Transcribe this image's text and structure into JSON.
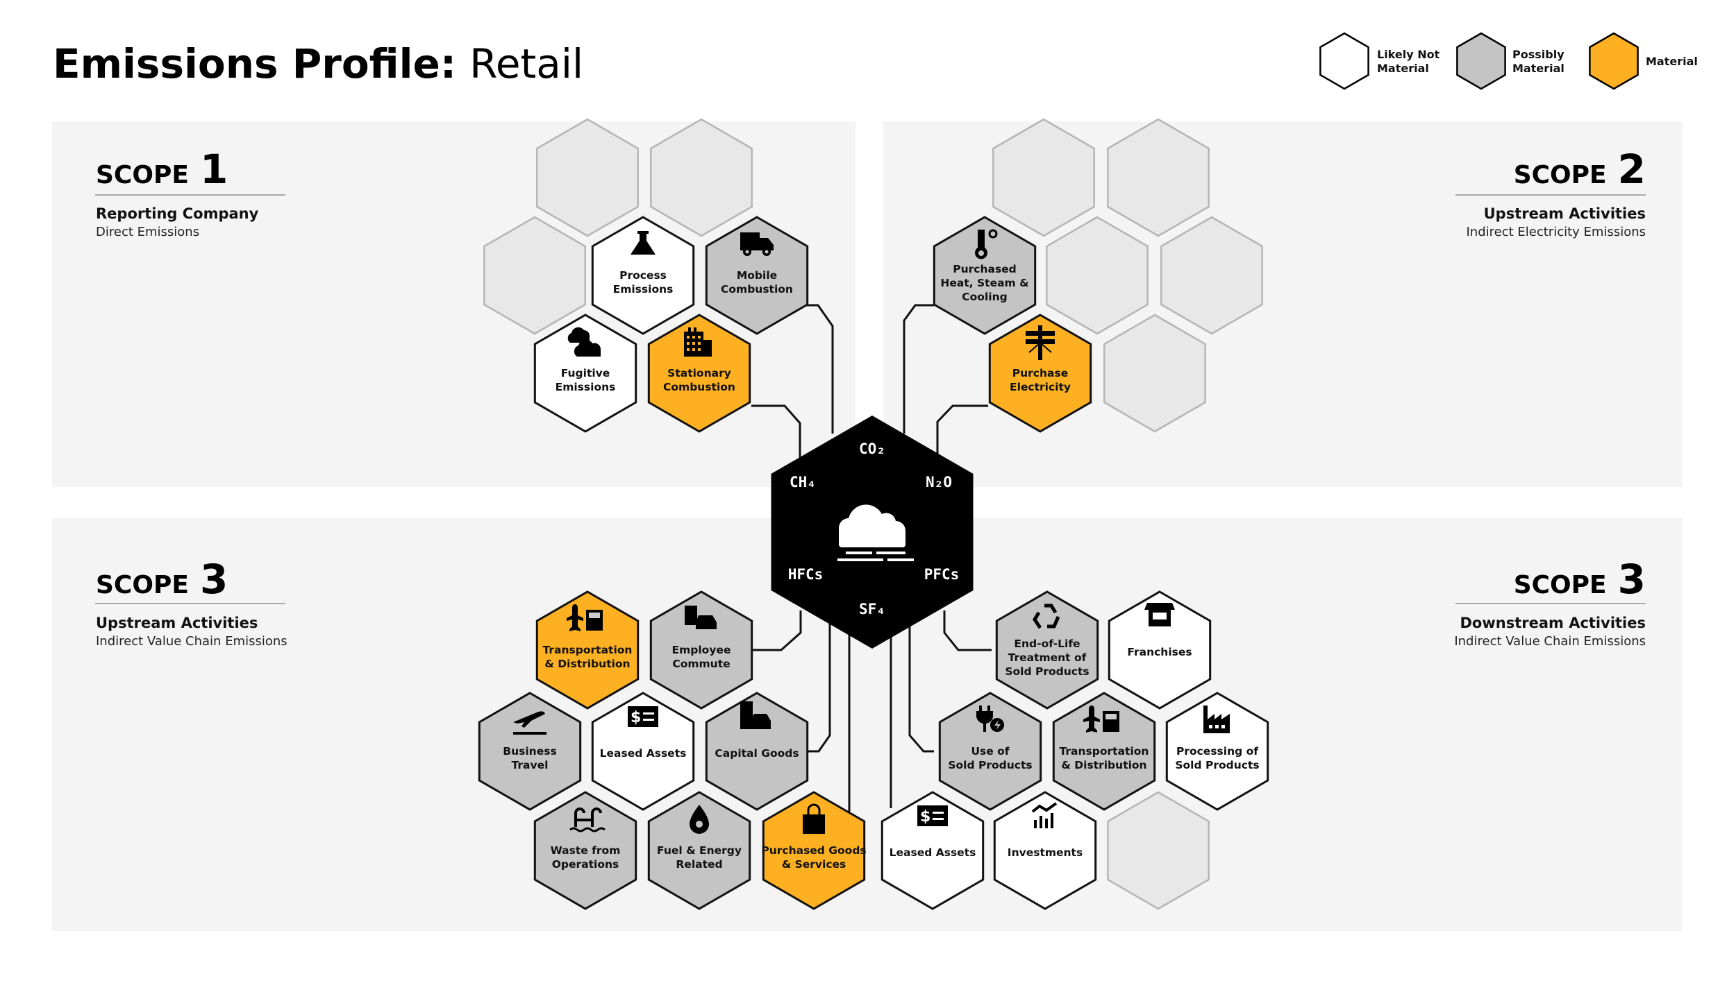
{
  "title": {
    "bold": "Emissions Profile:",
    "regular": "Retail"
  },
  "legend": [
    {
      "status": "likely-not",
      "lines": [
        "Likely Not",
        "Material"
      ]
    },
    {
      "status": "possibly",
      "lines": [
        "Possibly",
        "Material"
      ]
    },
    {
      "status": "material",
      "lines": [
        "Material"
      ]
    }
  ],
  "colors": {
    "likely-not": "#ffffff",
    "possibly": "#c4c4c4",
    "material": "#fdb022",
    "placeholder": "#e8e8e8",
    "panel": "#f4f4f4",
    "center": "#000000"
  },
  "scopes": [
    {
      "id": "scope1",
      "word": "SCOPE",
      "number": "1",
      "heading": "Reporting Company",
      "subheading": "Direct Emissions"
    },
    {
      "id": "scope2",
      "word": "SCOPE",
      "number": "2",
      "heading": "Upstream Activities",
      "subheading": "Indirect Electricity Emissions"
    },
    {
      "id": "scope3u",
      "word": "SCOPE",
      "number": "3",
      "heading": "Upstream Activities",
      "subheading": "Indirect Value Chain Emissions"
    },
    {
      "id": "scope3d",
      "word": "SCOPE",
      "number": "3",
      "heading": "Downstream Activities",
      "subheading": "Indirect Value Chain Emissions"
    }
  ],
  "center": {
    "gases": [
      "CO₂",
      "N₂O",
      "PFCs",
      "SF₄",
      "HFCs",
      "CH₄"
    ],
    "icon": "cloud-fog-icon"
  },
  "categories": [
    {
      "scope": "scope1",
      "lines": [
        "Process",
        "Emissions"
      ],
      "status": "likely-not",
      "icon": "flask-icon"
    },
    {
      "scope": "scope1",
      "lines": [
        "Mobile",
        "Combustion"
      ],
      "status": "possibly",
      "icon": "truck-icon"
    },
    {
      "scope": "scope1",
      "lines": [
        "Fugitive",
        "Emissions"
      ],
      "status": "likely-not",
      "icon": "clouds-icon"
    },
    {
      "scope": "scope1",
      "lines": [
        "Stationary",
        "Combustion"
      ],
      "status": "material",
      "icon": "building-icon"
    },
    {
      "scope": "scope2",
      "lines": [
        "Purchased",
        "Heat, Steam &",
        "Cooling"
      ],
      "status": "possibly",
      "icon": "thermometer-icon"
    },
    {
      "scope": "scope2",
      "lines": [
        "Purchase",
        "Electricity"
      ],
      "status": "material",
      "icon": "power-pole-icon"
    },
    {
      "scope": "scope3u",
      "lines": [
        "Transportation",
        "& Distribution"
      ],
      "status": "material",
      "icon": "plane-truck-icon"
    },
    {
      "scope": "scope3u",
      "lines": [
        "Employee",
        "Commute"
      ],
      "status": "possibly",
      "icon": "bus-car-icon"
    },
    {
      "scope": "scope3u",
      "lines": [
        "Business",
        "Travel"
      ],
      "status": "possibly",
      "icon": "plane-departure-icon"
    },
    {
      "scope": "scope3u",
      "lines": [
        "Leased Assets"
      ],
      "status": "likely-not",
      "icon": "lease-icon"
    },
    {
      "scope": "scope3u",
      "lines": [
        "Capital Goods"
      ],
      "status": "possibly",
      "icon": "building-car-icon"
    },
    {
      "scope": "scope3u",
      "lines": [
        "Waste from",
        "Operations"
      ],
      "status": "possibly",
      "icon": "waste-water-icon"
    },
    {
      "scope": "scope3u",
      "lines": [
        "Fuel & Energy",
        "Related"
      ],
      "status": "possibly",
      "icon": "drop-icon"
    },
    {
      "scope": "scope3u",
      "lines": [
        "Purchased Goods",
        "& Services"
      ],
      "status": "material",
      "icon": "shopping-bag-icon"
    },
    {
      "scope": "scope3d",
      "lines": [
        "End-of-Life",
        "Treatment of",
        "Sold Products"
      ],
      "status": "possibly",
      "icon": "recycle-icon"
    },
    {
      "scope": "scope3d",
      "lines": [
        "Franchises"
      ],
      "status": "likely-not",
      "icon": "storefront-icon"
    },
    {
      "scope": "scope3d",
      "lines": [
        "Use of",
        "Sold Products"
      ],
      "status": "possibly",
      "icon": "plug-icon"
    },
    {
      "scope": "scope3d",
      "lines": [
        "Transportation",
        "& Distribution"
      ],
      "status": "possibly",
      "icon": "plane-truck-icon"
    },
    {
      "scope": "scope3d",
      "lines": [
        "Processing of",
        "Sold Products"
      ],
      "status": "likely-not",
      "icon": "factory-icon"
    },
    {
      "scope": "scope3d",
      "lines": [
        "Leased Assets"
      ],
      "status": "likely-not",
      "icon": "lease-icon"
    },
    {
      "scope": "scope3d",
      "lines": [
        "Investments"
      ],
      "status": "likely-not",
      "icon": "chart-icon"
    }
  ]
}
